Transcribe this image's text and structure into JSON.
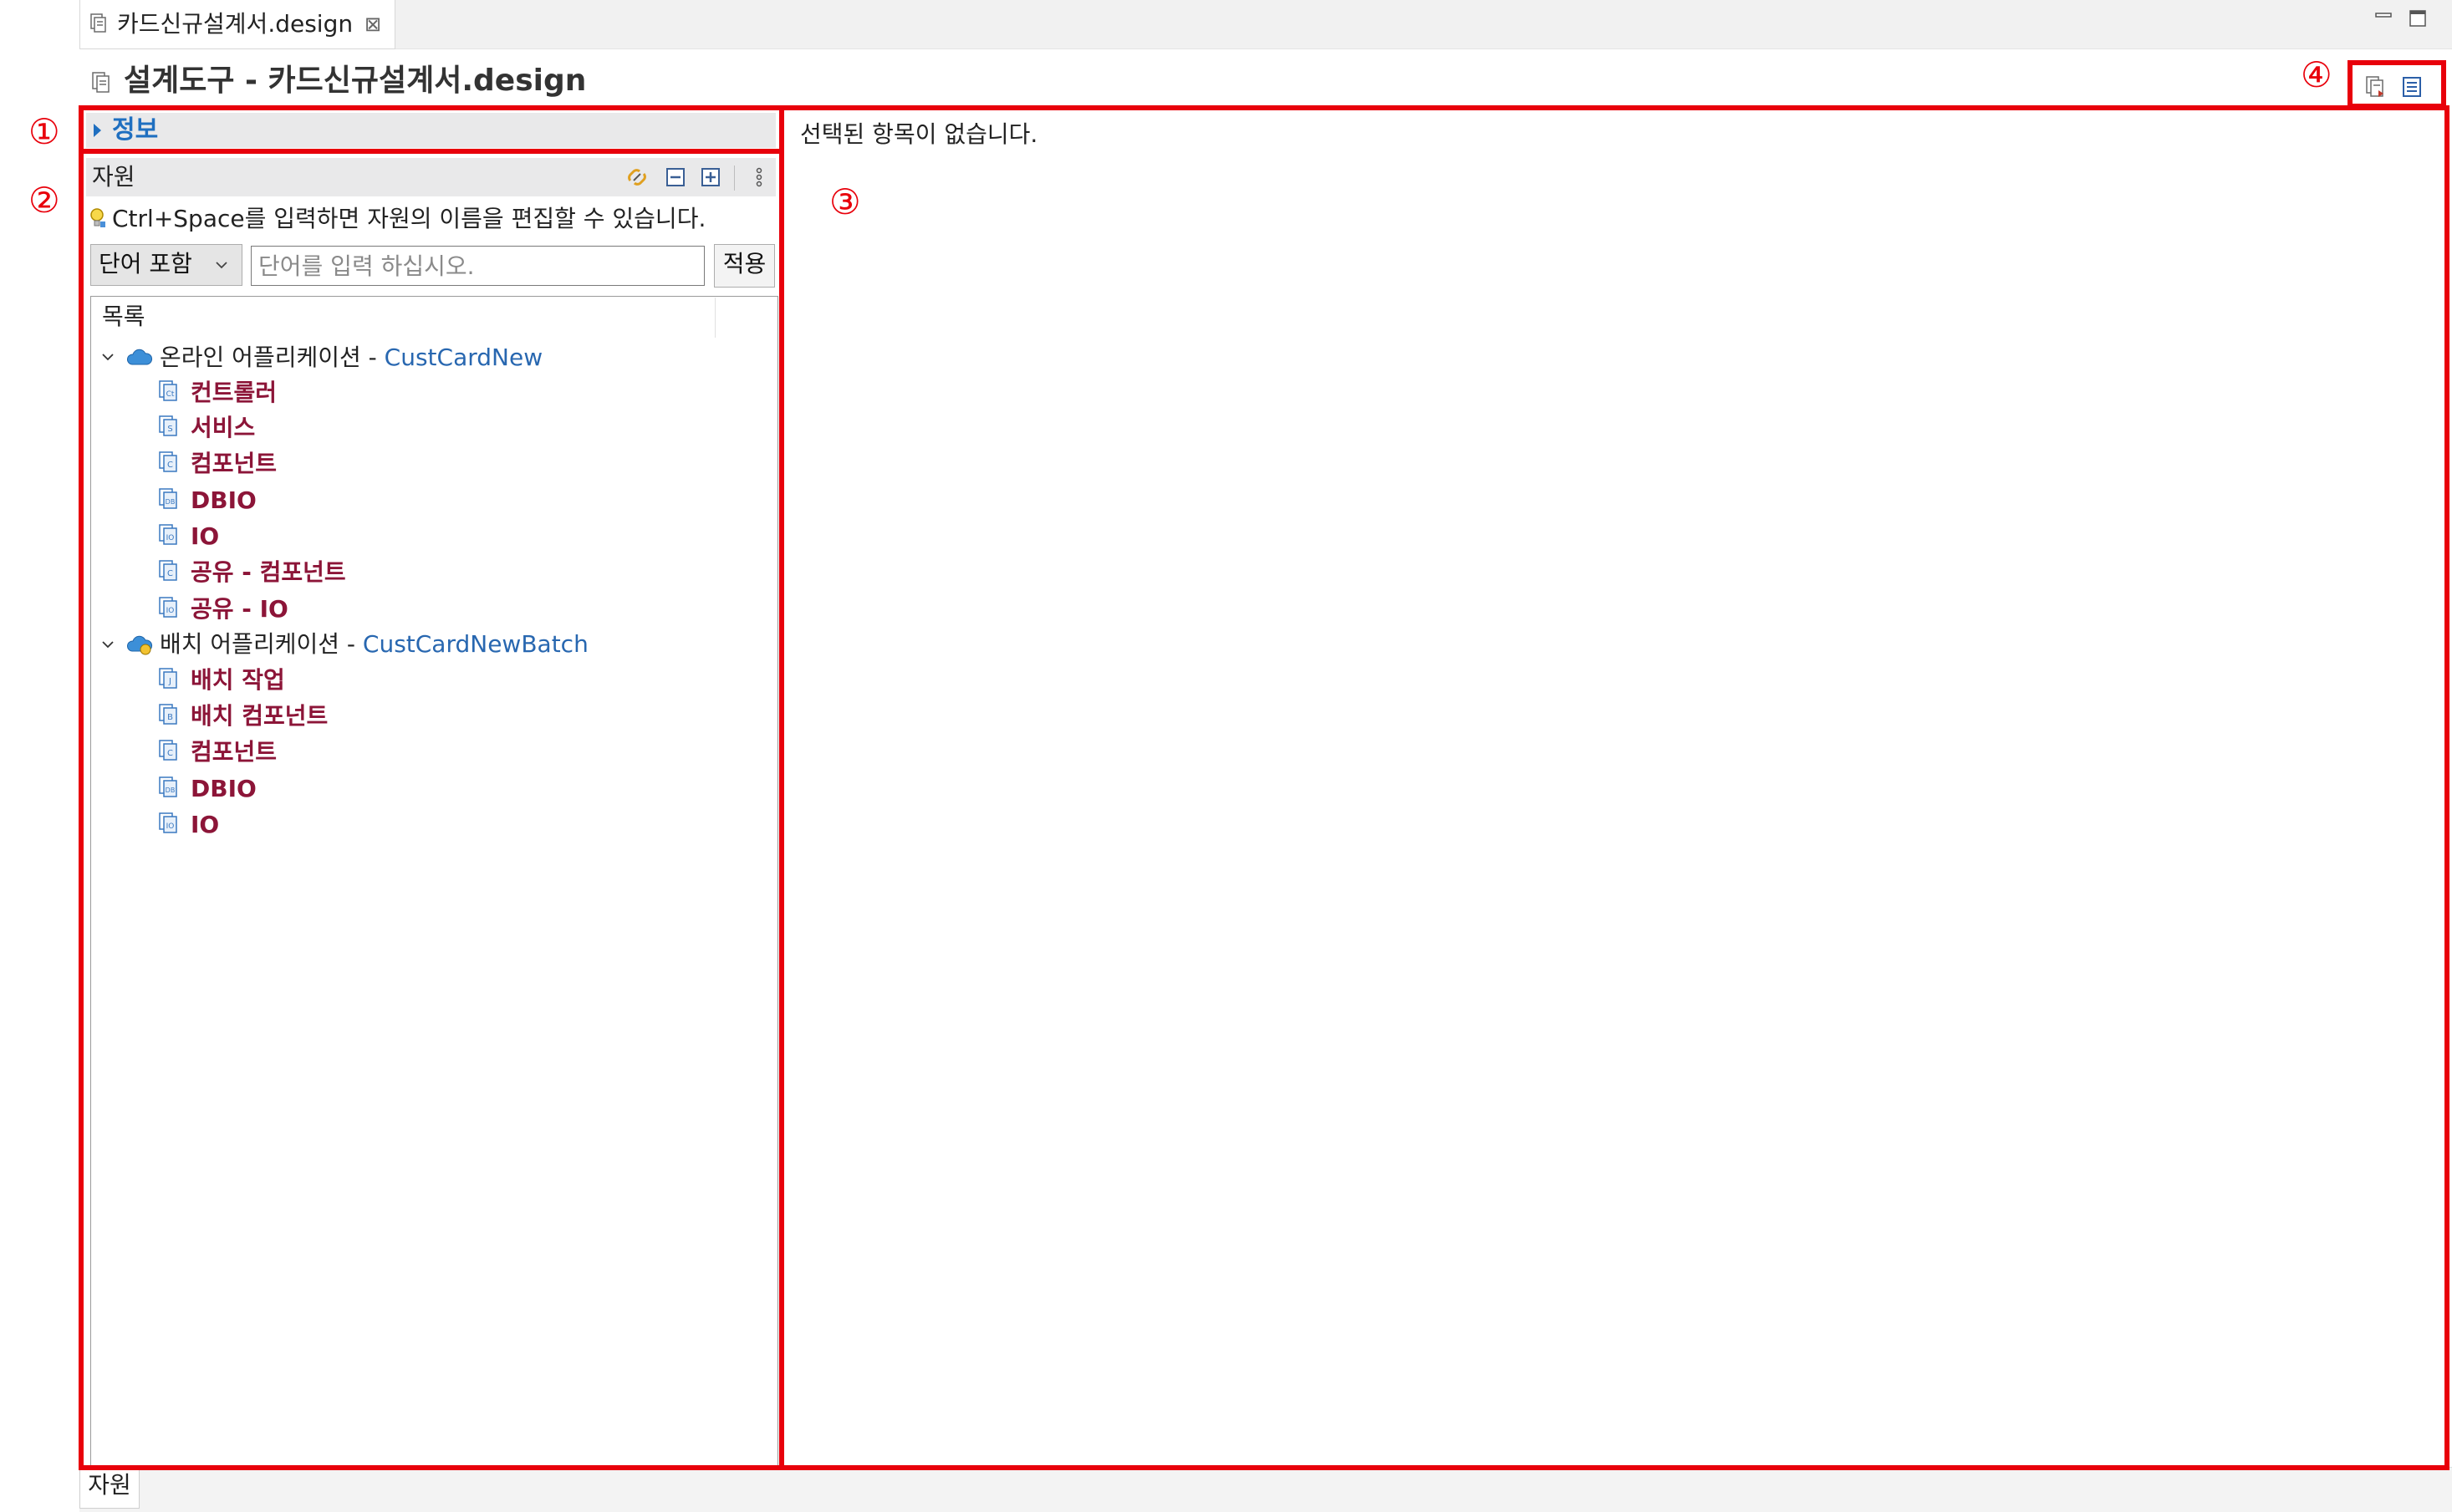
{
  "editor_tab": {
    "label": "카드신규설계서.design",
    "close": "⊠"
  },
  "title": "설계도구 - 카드신규설계서.design",
  "callouts": {
    "one": "①",
    "two": "②",
    "three": "③",
    "four": "④"
  },
  "info_section": {
    "label": "정보"
  },
  "resources": {
    "title": "자원",
    "tools": [
      "link-with-editor-icon",
      "collapse-all-icon",
      "expand-all-icon",
      "view-menu-icon"
    ],
    "hint": "Ctrl+Space를 입력하면 자원의 이름을 편집할 수 있습니다.",
    "filter_mode": "단어 포함",
    "search_placeholder": "단어를 입력 하십시오.",
    "apply_label": "적용",
    "tree_header": "목록",
    "apps": [
      {
        "name": "온라인 어플리케이션",
        "separator": " - ",
        "project": "CustCardNew",
        "children": [
          "컨트롤러",
          "서비스",
          "컴포넌트",
          "DBIO",
          "IO",
          "공유 - 컴포넌트",
          "공유 - IO"
        ]
      },
      {
        "name": "배치 어플리케이션",
        "separator": " - ",
        "project": "CustCardNewBatch",
        "children": [
          "배치 작업",
          "배치 컴포넌트",
          "컴포넌트",
          "DBIO",
          "IO"
        ]
      }
    ]
  },
  "detail": {
    "empty_message": "선택된 항목이 없습니다."
  },
  "bottom_tab": {
    "label": "자원"
  },
  "colors": {
    "callout_red": "#e8000b",
    "link_blue": "#2867b0",
    "node_red": "#8c1538",
    "info_blue": "#1f6fc0"
  }
}
